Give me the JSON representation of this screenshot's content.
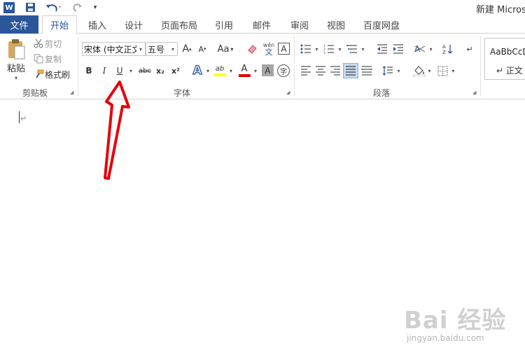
{
  "title_bar": {
    "app_icon_letter": "W",
    "window_title": "新建 Micros",
    "qat_more": "▾"
  },
  "tabs": {
    "file": "文件",
    "items": [
      "开始",
      "插入",
      "设计",
      "页面布局",
      "引用",
      "邮件",
      "审阅",
      "视图",
      "百度网盘"
    ]
  },
  "clipboard": {
    "paste": "粘贴",
    "cut": "剪切",
    "copy": "复制",
    "format_painter": "格式刷",
    "group_label": "剪贴板"
  },
  "font": {
    "font_name": "宋体 (中文正文",
    "font_size": "五号",
    "grow": "A",
    "shrink": "A",
    "change_case": "Aa",
    "phonetic_top": "wén",
    "phonetic_bottom": "文",
    "char_border": "A",
    "bold": "B",
    "italic": "I",
    "underline": "U",
    "strikethrough": "abc",
    "subscript": "x₂",
    "superscript": "x²",
    "text_effects": "A",
    "highlight": "ab",
    "font_color": "A",
    "char_shading": "A",
    "enclose": "字",
    "group_label": "字体"
  },
  "paragraph": {
    "group_label": "段落"
  },
  "styles": {
    "normal_sample": "AaBbCcD",
    "normal_label": "↵ 正文"
  },
  "document": {
    "paragraph_mark": "↵"
  },
  "watermark": {
    "brand": "Bai 经验",
    "url": "jingyan.baidu.com"
  },
  "colors": {
    "accent": "#2b579a",
    "arrow": "#e8000b",
    "highlight_yellow": "#ffff00",
    "font_red": "#e00000"
  }
}
